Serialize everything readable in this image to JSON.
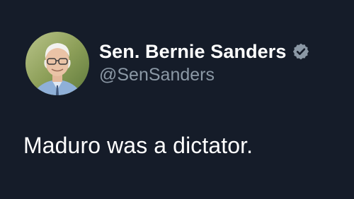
{
  "tweet": {
    "author": {
      "display_name": "Sen. Bernie Sanders",
      "handle": "@SenSanders",
      "verified": true,
      "verified_badge_icon": "verified-badge-icon",
      "verified_color": "#8b98a5"
    },
    "text": "Maduro was a dictator."
  },
  "colors": {
    "background": "#151c29",
    "primary_text": "#ffffff",
    "secondary_text": "#8b98a5"
  }
}
